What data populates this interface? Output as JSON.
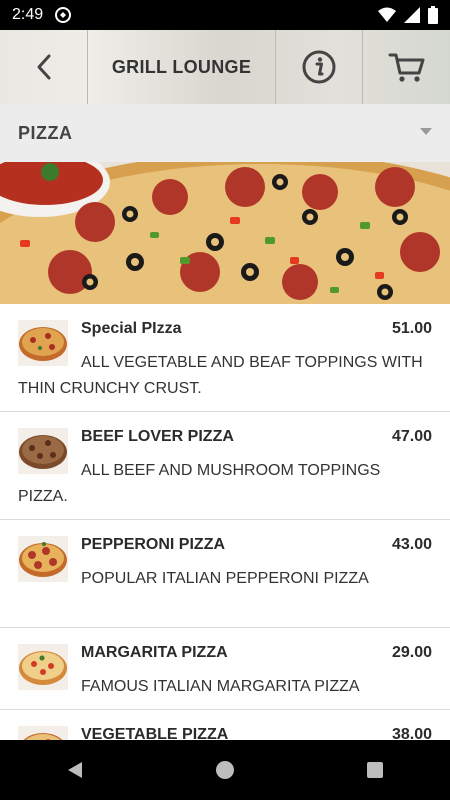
{
  "status": {
    "time": "2:49"
  },
  "header": {
    "title": "GRILL LOUNGE"
  },
  "category": {
    "name": "PIZZA"
  },
  "menu": {
    "items": [
      {
        "name": "Special PIzza",
        "price": "51.00",
        "description": "ALL VEGETABLE AND BEAF TOPPINGS WITH THIN CRUNCHY CRUST."
      },
      {
        "name": "BEEF LOVER PIZZA",
        "price": "47.00",
        "description": "ALL BEEF AND MUSHROOM TOPPINGS PIZZA."
      },
      {
        "name": "PEPPERONI PIZZA",
        "price": "43.00",
        "description": "POPULAR ITALIAN PEPPERONI PIZZA"
      },
      {
        "name": "MARGARITA PIZZA",
        "price": "29.00",
        "description": "FAMOUS ITALIAN MARGARITA PIZZA"
      },
      {
        "name": "VEGETABLE PIZZA",
        "price": "38.00",
        "description": ""
      }
    ]
  },
  "icons": {
    "back": "chevron-left-icon",
    "info": "info-icon",
    "cart": "cart-icon",
    "nav_back": "triangle-back-icon",
    "nav_home": "circle-home-icon",
    "nav_recents": "square-recents-icon"
  },
  "colors": {
    "status_bar": "#000000",
    "category_bar": "#ececec",
    "text": "#2b2b2b",
    "divider": "#dcdcdc"
  }
}
